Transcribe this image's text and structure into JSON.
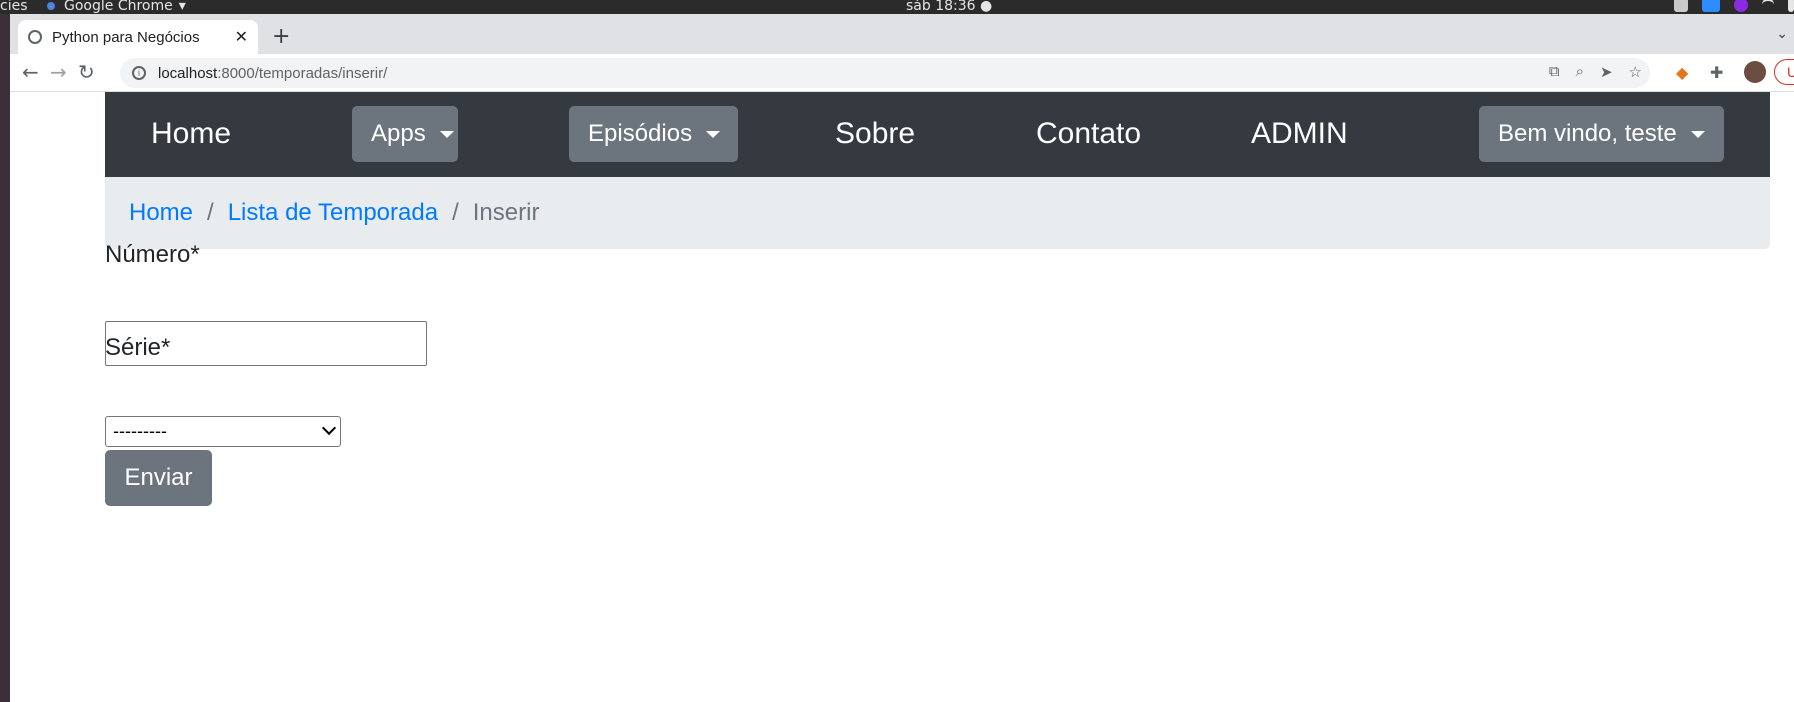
{
  "os": {
    "activities": "cies",
    "app_name": "Google Chrome",
    "app_menu_caret": "▾",
    "clock": "sáb 18:36 ●"
  },
  "browser": {
    "tab_title": "Python para Negócios",
    "tab_close": "✕",
    "new_tab": "+",
    "url_host": "localhost",
    "url_path": ":8000/temporadas/inserir/",
    "update_label": "Up"
  },
  "navbar": {
    "home": "Home",
    "apps": "Apps",
    "episodios": "Episódios",
    "sobre": "Sobre",
    "contato": "Contato",
    "admin": "ADMIN",
    "user_menu": "Bem vindo, teste"
  },
  "breadcrumb": {
    "home": "Home",
    "separator": "/",
    "list": "Lista de Temporada",
    "current": "Inserir"
  },
  "form": {
    "numero_label": "Número*",
    "numero_value": "",
    "serie_label": "Série*",
    "serie_selected": "---------",
    "submit_label": "Enviar"
  },
  "colors": {
    "navbar_bg": "#343a40",
    "button_secondary": "#6c757d",
    "breadcrumb_bg": "#e9ecef",
    "link": "#007bff"
  }
}
